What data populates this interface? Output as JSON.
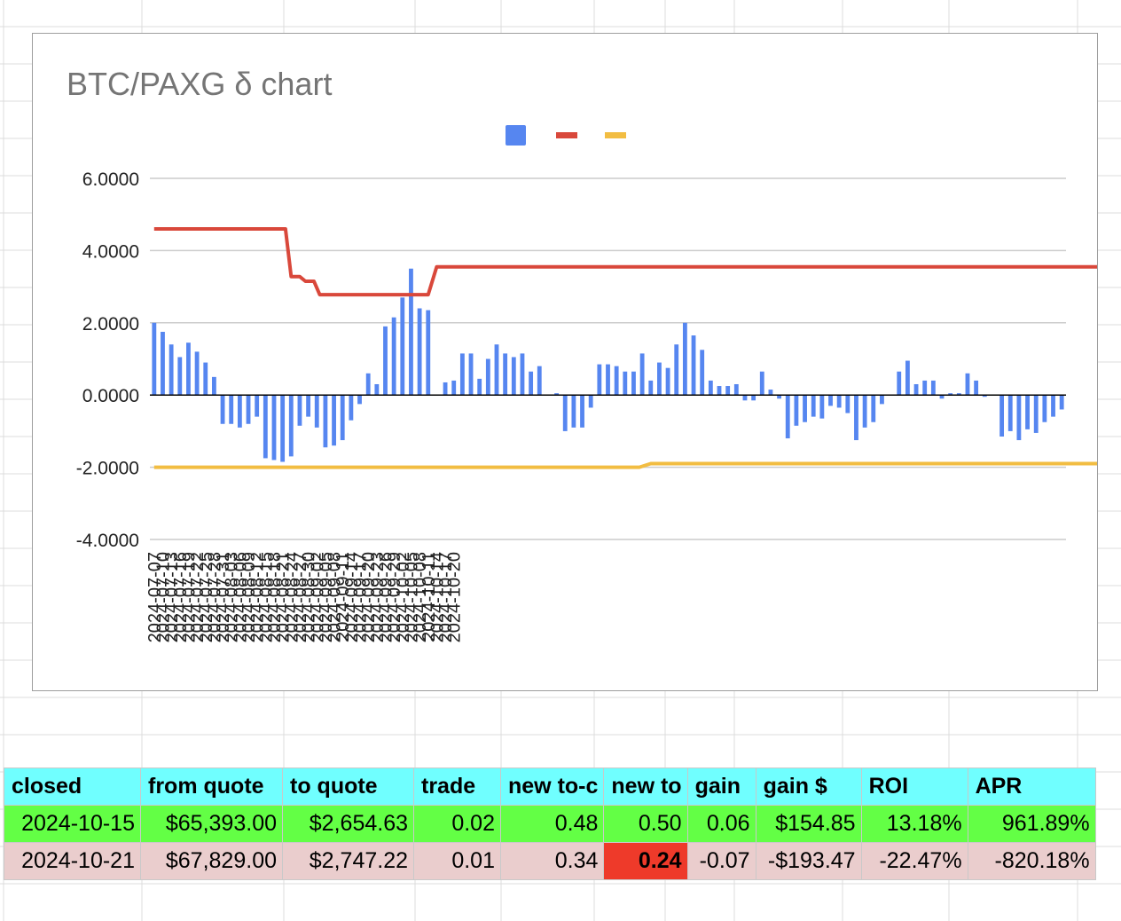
{
  "chart_data": {
    "type": "bar",
    "title": "BTC/PAXG δ chart",
    "legend": {
      "placement": "top",
      "swatches": [
        "bar-blue",
        "line-red",
        "line-yellow"
      ]
    },
    "ylim": [
      -4,
      6
    ],
    "yticks": [
      "6.0000",
      "4.0000",
      "2.0000",
      "0.0000",
      "-2.0000",
      "-4.0000"
    ],
    "ytick_values": [
      6,
      4,
      2,
      0,
      -2,
      -4
    ],
    "xtick_labels": [
      "2024-07-07",
      "2024-07-10",
      "2024-07-13",
      "2024-07-16",
      "2024-07-19",
      "2024-07-22",
      "2024-07-25",
      "2024-07-28",
      "2024-07-31",
      "2024-08-03",
      "2024-08-06",
      "2024-08-09",
      "2024-08-12",
      "2024-08-15",
      "2024-08-18",
      "2024-08-21",
      "2024-08-24",
      "2024-08-27",
      "2024-08-30",
      "2024-09-02",
      "2024-09-05",
      "2024-09-08",
      "2024-09-11",
      "2024-09-14",
      "2024-09-17",
      "2024-09-20",
      "2024-09-23",
      "2024-09-26",
      "2024-09-29",
      "2024-10-02",
      "2024-10-05",
      "2024-10-08",
      "2024-10-11",
      "2024-10-14",
      "2024-10-17",
      "2024-10-20"
    ],
    "x_start": "2024-07-07",
    "grid": true,
    "colors": {
      "bars": "#5686f0",
      "upper": "#d9483b",
      "lower": "#f2bd42",
      "zero": "#000000",
      "grid": "#cccccc",
      "text": "#222222"
    },
    "series": [
      {
        "type": "bar",
        "values": [
          2.0,
          1.75,
          1.4,
          1.05,
          1.45,
          1.2,
          0.9,
          0.5,
          -0.8,
          -0.8,
          -0.9,
          -0.8,
          -0.6,
          -1.75,
          -1.8,
          -1.85,
          -1.7,
          -0.85,
          -0.6,
          -0.9,
          -1.45,
          -1.4,
          -1.25,
          -0.7,
          -0.25,
          0.6,
          0.3,
          1.9,
          2.15,
          2.7,
          3.5,
          2.4,
          2.35,
          0,
          0.35,
          0.4,
          1.15,
          1.15,
          0.45,
          1.0,
          1.4,
          1.15,
          1.05,
          1.15,
          0.65,
          0.8,
          0,
          0.05,
          -1.0,
          -0.9,
          -0.9,
          -0.35,
          0.85,
          0.85,
          0.8,
          0.65,
          0.65,
          1.15,
          0.4,
          0.9,
          0.75,
          1.4,
          2.0,
          1.65,
          1.25,
          0.4,
          0.25,
          0.25,
          0.3,
          -0.15,
          -0.15,
          0.65,
          0.15,
          -0.1,
          -1.2,
          -0.85,
          -0.75,
          -0.6,
          -0.65,
          -0.3,
          -0.35,
          -0.5,
          -1.25,
          -0.9,
          -0.75,
          -0.25,
          0,
          0.65,
          0.95,
          0.3,
          0.4,
          0.4,
          -0.1,
          0.05,
          0.05,
          0.6,
          0.4,
          -0.05,
          0,
          -1.15,
          -1.0,
          -1.25,
          -0.95,
          -1.05,
          -0.75,
          -0.6,
          -0.4
        ]
      },
      {
        "type": "line",
        "points": [
          [
            0,
            4.6
          ],
          [
            46,
            4.6
          ],
          [
            48,
            3.28
          ],
          [
            51,
            3.28
          ],
          [
            53,
            3.15
          ],
          [
            56,
            3.15
          ],
          [
            58,
            2.78
          ],
          [
            96,
            2.78
          ],
          [
            99,
            3.55
          ],
          [
            359,
            3.55
          ]
        ]
      },
      {
        "type": "line",
        "points": [
          [
            0,
            -2.0
          ],
          [
            170,
            -2.0
          ],
          [
            174,
            -1.9
          ],
          [
            359,
            -1.9
          ]
        ]
      }
    ]
  },
  "table": {
    "headers": [
      "closed",
      "from quote",
      "to quote",
      "trade",
      "new to-c",
      "new to",
      "gain",
      "gain $",
      "ROI",
      "APR"
    ],
    "rows": [
      [
        "2024-10-15",
        "$65,393.00",
        "$2,654.63",
        "0.02",
        "0.48",
        "0.50",
        "0.06",
        "$154.85",
        "13.18%",
        "961.89%"
      ],
      [
        "2024-10-21",
        "$67,829.00",
        "$2,747.22",
        "0.01",
        "0.34",
        "0.24",
        "-0.07",
        "-$193.47",
        "-22.47%",
        "-820.18%"
      ]
    ]
  }
}
